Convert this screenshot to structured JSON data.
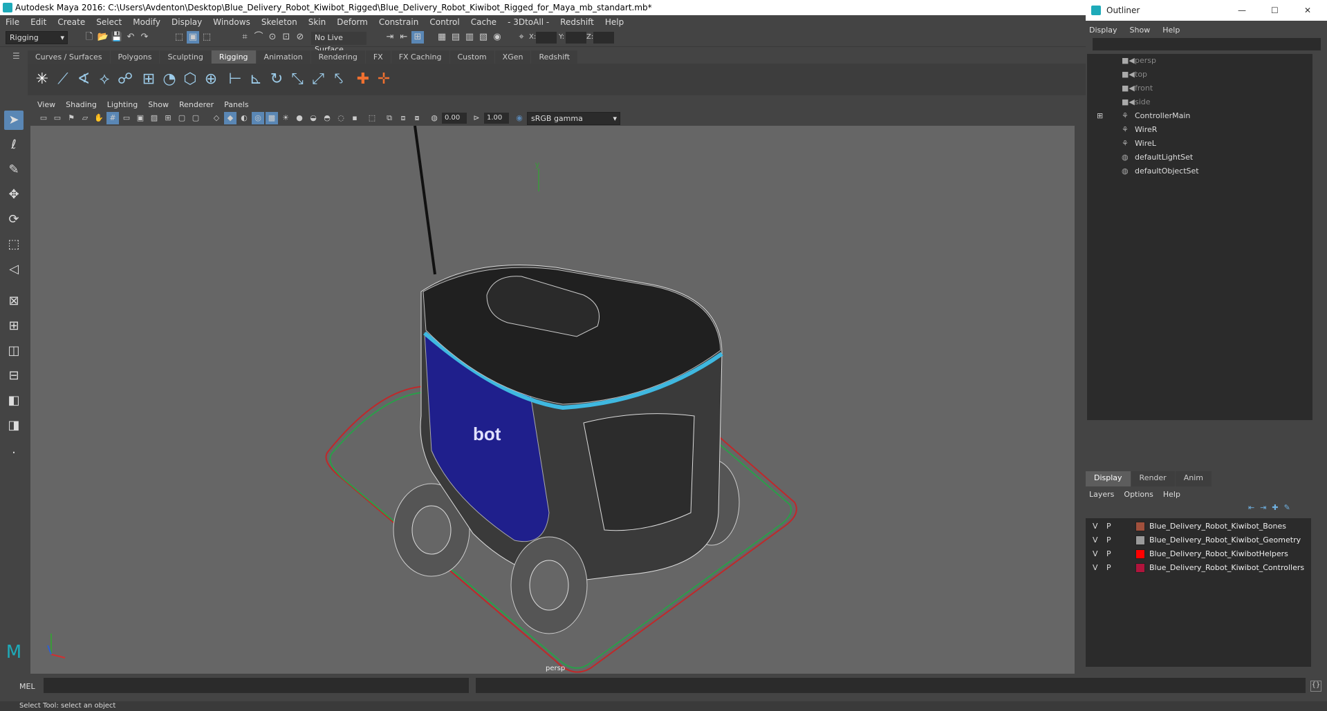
{
  "window": {
    "title": "Autodesk Maya 2016: C:\\Users\\Avdenton\\Desktop\\Blue_Delivery_Robot_Kiwibot_Rigged\\Blue_Delivery_Robot_Kiwibot_Rigged_for_Maya_mb_standart.mb*"
  },
  "menubar": {
    "items": [
      "File",
      "Edit",
      "Create",
      "Select",
      "Modify",
      "Display",
      "Windows",
      "Skeleton",
      "Skin",
      "Deform",
      "Constrain",
      "Control",
      "Cache",
      "- 3DtoAll -",
      "Redshift",
      "Help"
    ]
  },
  "statusline": {
    "mode": "Rigging",
    "live_surface": "No Live Surface",
    "x_label": "X:",
    "y_label": "Y:",
    "z_label": "Z:"
  },
  "shelf": {
    "tabs": [
      "Curves / Surfaces",
      "Polygons",
      "Sculpting",
      "Rigging",
      "Animation",
      "Rendering",
      "FX",
      "FX Caching",
      "Custom",
      "XGen",
      "Redshift"
    ],
    "active": "Rigging"
  },
  "viewport": {
    "menu": [
      "View",
      "Shading",
      "Lighting",
      "Show",
      "Renderer",
      "Panels"
    ],
    "exposure": "0.00",
    "gamma": "1.00",
    "color_space": "sRGB gamma",
    "camera_label": "persp",
    "model_text": "bot"
  },
  "outliner": {
    "title": "Outliner",
    "menu": [
      "Display",
      "Show",
      "Help"
    ],
    "items": [
      {
        "label": "persp",
        "icon": "camera-icon",
        "dim": true
      },
      {
        "label": "top",
        "icon": "camera-icon",
        "dim": true
      },
      {
        "label": "front",
        "icon": "camera-icon",
        "dim": true
      },
      {
        "label": "side",
        "icon": "camera-icon",
        "dim": true
      },
      {
        "label": "ControllerMain",
        "icon": "curve-icon",
        "dim": false,
        "expandable": true
      },
      {
        "label": "WireR",
        "icon": "curve-icon",
        "dim": false
      },
      {
        "label": "WireL",
        "icon": "curve-icon",
        "dim": false
      },
      {
        "label": "defaultLightSet",
        "icon": "set-icon",
        "dim": false
      },
      {
        "label": "defaultObjectSet",
        "icon": "set-icon",
        "dim": false
      }
    ]
  },
  "layers": {
    "tabs": [
      "Display",
      "Render",
      "Anim"
    ],
    "active": "Display",
    "menu": [
      "Layers",
      "Options",
      "Help"
    ],
    "rows": [
      {
        "v": "V",
        "p": "P",
        "color": "#a0503c",
        "name": "Blue_Delivery_Robot_Kiwibot_Bones"
      },
      {
        "v": "V",
        "p": "P",
        "color": "#9a9a9a",
        "name": "Blue_Delivery_Robot_Kiwibot_Geometry"
      },
      {
        "v": "V",
        "p": "P",
        "color": "#ff0000",
        "name": "Blue_Delivery_Robot_KiwibotHelpers"
      },
      {
        "v": "V",
        "p": "P",
        "color": "#b0143c",
        "name": "Blue_Delivery_Robot_Kiwibot_Controllers"
      }
    ]
  },
  "commandline": {
    "label": "MEL"
  },
  "helpline": {
    "text": "Select Tool: select an object"
  }
}
